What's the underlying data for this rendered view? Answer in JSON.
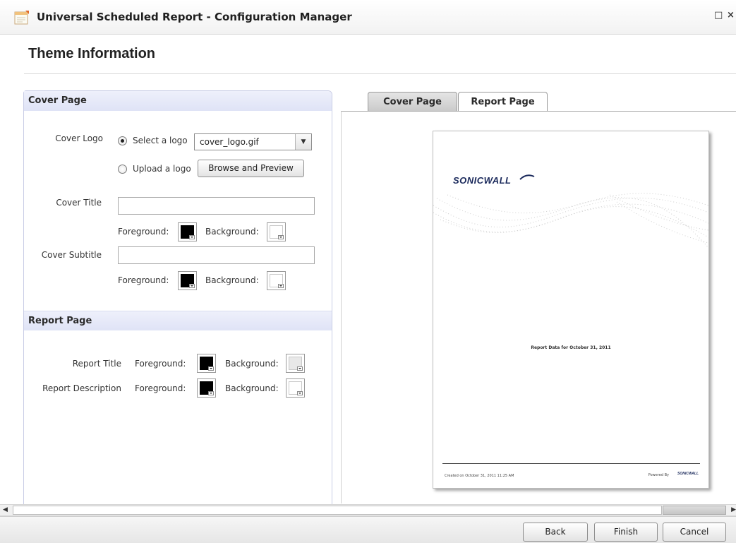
{
  "window": {
    "title": "Universal Scheduled Report - Configuration Manager",
    "maximize_glyph": "□",
    "close_glyph": "×",
    "app_icon": "report-calendar-icon"
  },
  "page": {
    "heading": "Theme Information"
  },
  "cover_page": {
    "header": "Cover Page",
    "logo_label": "Cover Logo",
    "select_logo_option": "Select a logo",
    "select_logo_checked": true,
    "logo_dropdown_value": "cover_logo.gif",
    "upload_logo_option": "Upload a logo",
    "upload_logo_checked": false,
    "browse_button": "Browse and Preview",
    "title_label": "Cover Title",
    "title_value": "",
    "title_fg_label": "Foreground:",
    "title_bg_label": "Background:",
    "title_fg_color": "#000000",
    "title_bg_color": "#ffffff",
    "subtitle_label": "Cover Subtitle",
    "subtitle_value": "",
    "subtitle_fg_label": "Foreground:",
    "subtitle_bg_label": "Background:",
    "subtitle_fg_color": "#000000",
    "subtitle_bg_color": "#ffffff"
  },
  "report_page": {
    "header": "Report Page",
    "title_label": "Report Title",
    "title_fg_label": "Foreground:",
    "title_bg_label": "Background:",
    "title_fg_color": "#000000",
    "title_bg_color": "#e8e8e8",
    "description_label": "Report Description",
    "description_fg_label": "Foreground:",
    "description_bg_label": "Background:",
    "description_fg_color": "#000000",
    "description_bg_color": "#ffffff"
  },
  "preview": {
    "tabs": [
      {
        "label": "Cover Page",
        "active": true
      },
      {
        "label": "Report Page",
        "active": false
      }
    ],
    "logo_text": "SONICWALL",
    "report_date": "Report Data for  October 31, 2011",
    "created": "Created on October 31, 2011  11:25 AM",
    "powered_by": "Powered By",
    "mini_logo": "SONICWALL"
  },
  "footer": {
    "back_button": "Back",
    "finish_button": "Finish",
    "cancel_button": "Cancel"
  },
  "colors": {
    "section_header_bg": "#dfe3f6",
    "panel_border": "#c9cde6",
    "logo_navy": "#1b2a5c"
  }
}
